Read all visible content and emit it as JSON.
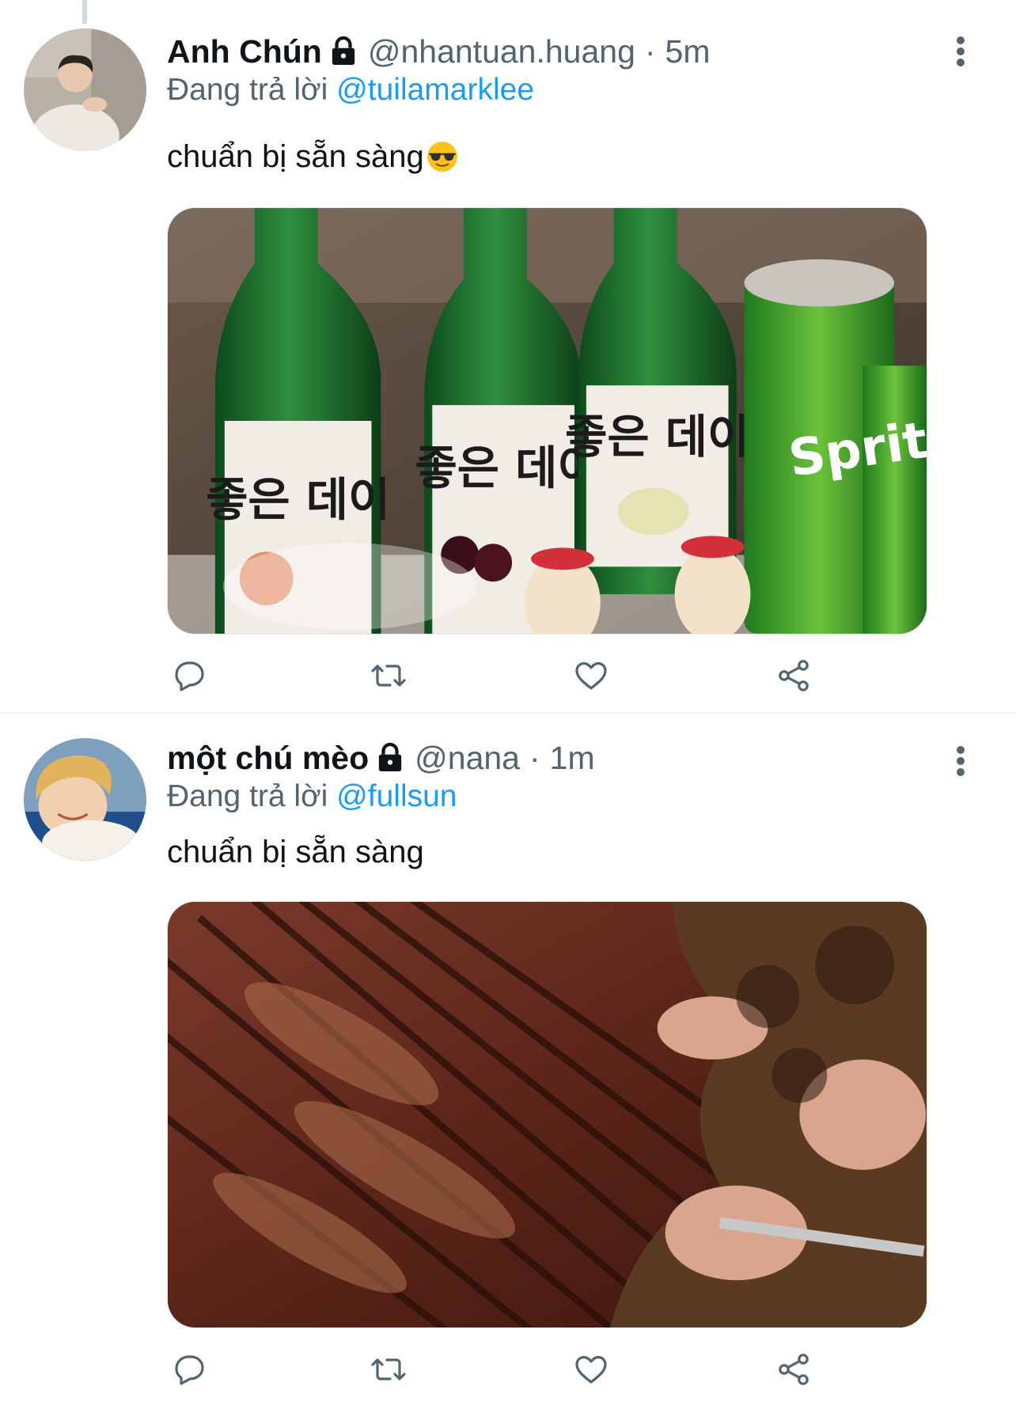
{
  "colors": {
    "link": "#1d9bf0",
    "secondary_text": "#536471",
    "primary_text": "#0f1419",
    "divider": "#eff3f4"
  },
  "tweets": [
    {
      "display_name": "Anh Chún",
      "locked": true,
      "handle": "@nhantuan.huang",
      "separator": "·",
      "time": "5m",
      "replying_prefix": "Đang trả lời",
      "replying_to": "@tuilamarklee",
      "text": "chuẩn bị sẵn sàng",
      "emoji": "smiling-face-with-sunglasses",
      "media": "photo of soju bottles and sprite cans",
      "media_label_texts": [
        "좋은 데이",
        "좋은 데이",
        "좋은 데이",
        "Sprite"
      ],
      "actions": [
        "reply-icon",
        "retweet-icon",
        "like-icon",
        "share-icon"
      ]
    },
    {
      "display_name": "một chú mèo",
      "locked": true,
      "handle": "@nana",
      "separator": "·",
      "time": "1m",
      "replying_prefix": "Đang trả lời",
      "replying_to": "@fullsun",
      "text": "chuẩn bị sẵn sàng",
      "media": "photo of grilled sliced meat",
      "actions": [
        "reply-icon",
        "retweet-icon",
        "like-icon",
        "share-icon"
      ]
    }
  ]
}
